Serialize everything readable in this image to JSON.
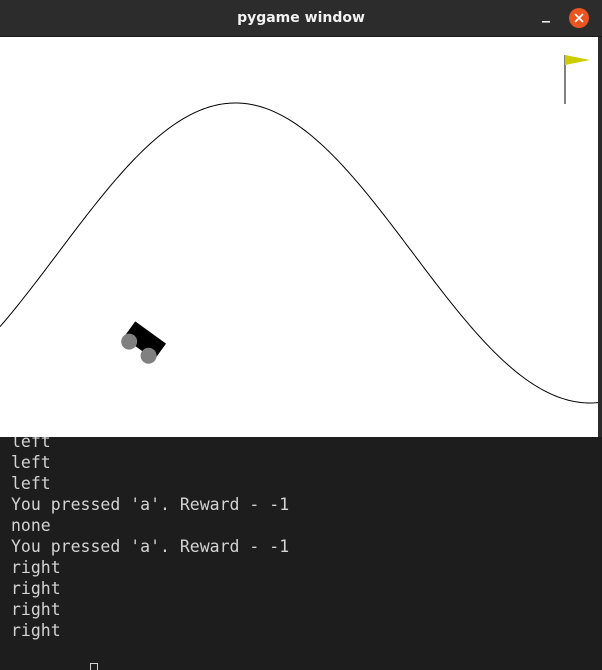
{
  "window": {
    "title": "pygame window",
    "minimize_icon": "minimize-icon",
    "close_icon": "close-icon",
    "close_color": "#e95420"
  },
  "game": {
    "background": "#ffffff",
    "flag_color": "#cccc00",
    "car_color": "#000000",
    "wheel_color": "#808080",
    "track_color": "#000000"
  },
  "terminal": {
    "lines": [
      "left",
      "left",
      "left",
      "You pressed 'a'. Reward - -1",
      "none",
      "You pressed 'a'. Reward - -1",
      "right",
      "right",
      "right",
      "right"
    ],
    "cursor_icon": "block-cursor-icon"
  }
}
